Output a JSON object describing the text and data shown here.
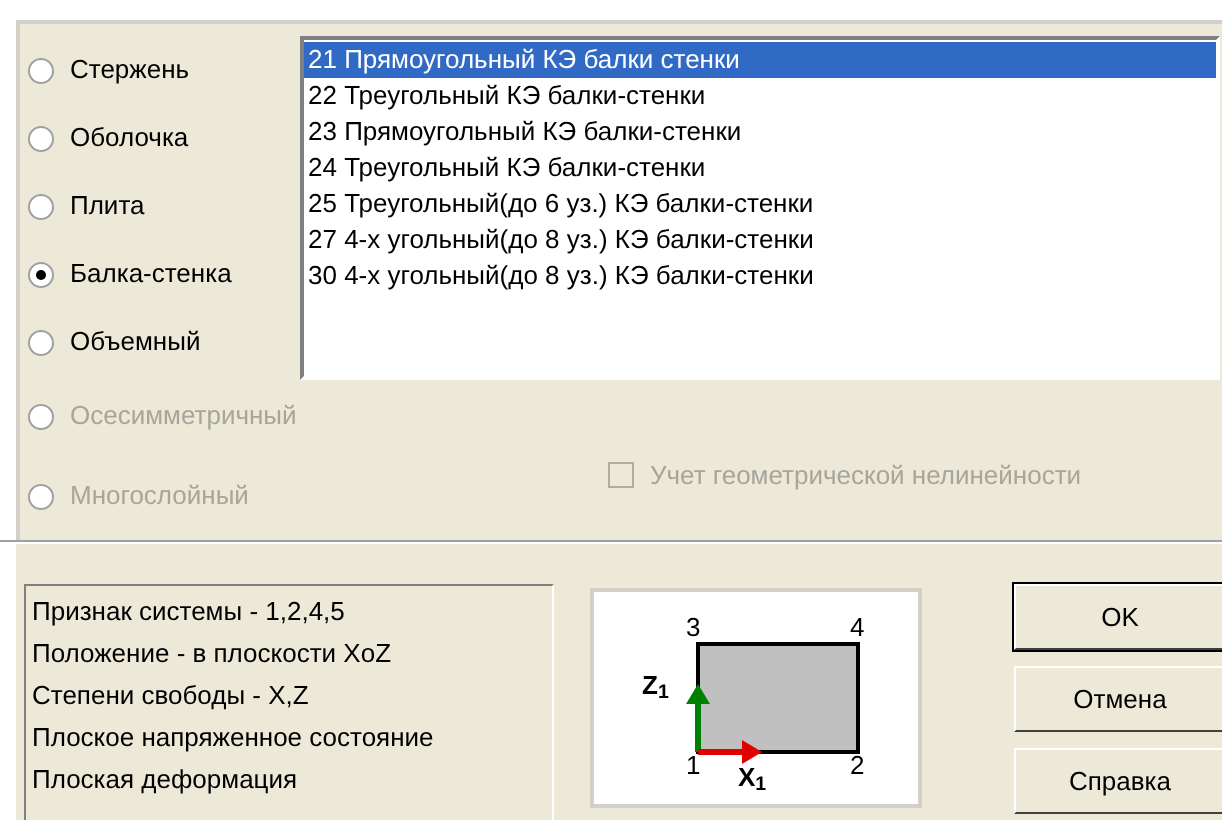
{
  "element_types": [
    {
      "label": "Стержень",
      "selected": false,
      "disabled": false
    },
    {
      "label": "Оболочка",
      "selected": false,
      "disabled": false
    },
    {
      "label": "Плита",
      "selected": false,
      "disabled": false
    },
    {
      "label": "Балка-стенка",
      "selected": true,
      "disabled": false
    },
    {
      "label": "Объемный",
      "selected": false,
      "disabled": false
    },
    {
      "label": "Осесимметричный",
      "selected": false,
      "disabled": true
    },
    {
      "label": "Многослойный",
      "selected": false,
      "disabled": true
    }
  ],
  "element_list": [
    {
      "label": "21 Прямоугольный КЭ балки стенки",
      "selected": true
    },
    {
      "label": "22 Треугольный КЭ балки-стенки",
      "selected": false
    },
    {
      "label": "23 Прямоугольный КЭ балки-стенки",
      "selected": false
    },
    {
      "label": "24 Треугольный КЭ балки-стенки",
      "selected": false
    },
    {
      "label": "25 Треугольный(до 6 уз.) КЭ балки-стенки",
      "selected": false
    },
    {
      "label": "27 4-х угольный(до 8 уз.) КЭ балки-стенки",
      "selected": false
    },
    {
      "label": "30 4-х угольный(до 8 уз.) КЭ балки-стенки",
      "selected": false
    }
  ],
  "geometric_nonlinearity": {
    "label": "Учет геометрической нелинейности",
    "checked": false,
    "disabled": true
  },
  "info_lines": [
    "Признак системы - 1,2,4,5",
    "Положение - в плоскости XoZ",
    "Степени свободы - X,Z",
    "Плоское напряженное состояние",
    "Плоская деформация"
  ],
  "diagram": {
    "nodes": [
      "3",
      "4",
      "1",
      "2"
    ],
    "axis_x": "X$_{1}$",
    "axis_z": "Z$_{1}$"
  },
  "buttons": [
    "OK",
    "Отмена",
    "Справка"
  ]
}
